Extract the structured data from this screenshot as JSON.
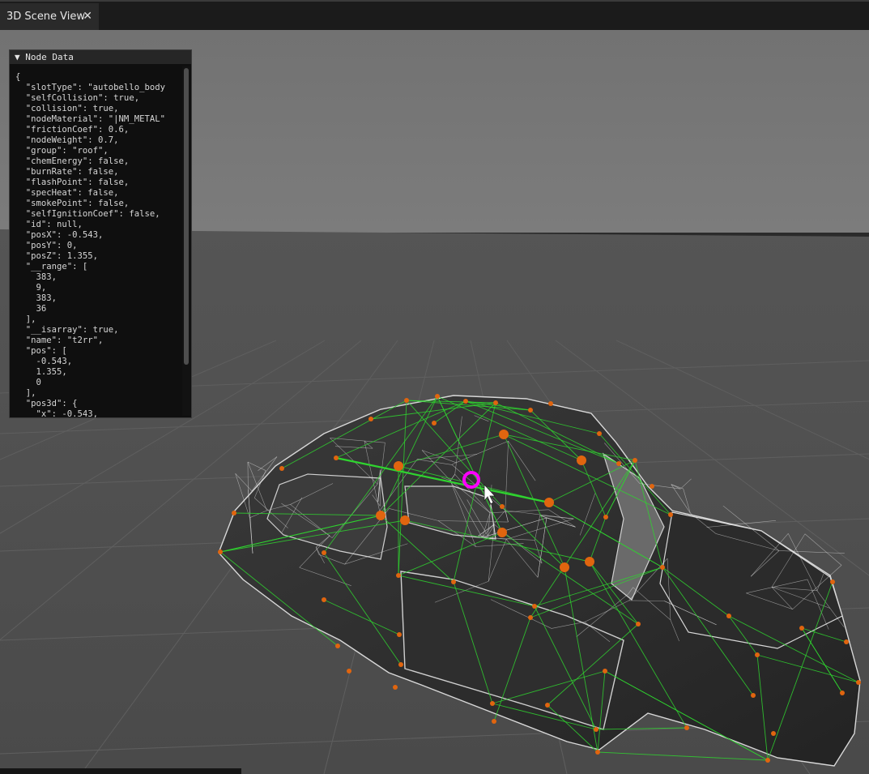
{
  "tab": {
    "label": "3D Scene View",
    "close_label": "✕"
  },
  "panel": {
    "title": "▼ Node Data",
    "json_lines": [
      "{",
      "  \"slotType\": \"autobello_body",
      "  \"selfCollision\": true,",
      "  \"collision\": true,",
      "  \"nodeMaterial\": \"|NM_METAL\"",
      "  \"frictionCoef\": 0.6,",
      "  \"nodeWeight\": 0.7,",
      "  \"group\": \"roof\",",
      "  \"chemEnergy\": false,",
      "  \"burnRate\": false,",
      "  \"flashPoint\": false,",
      "  \"specHeat\": false,",
      "  \"smokePoint\": false,",
      "  \"selfIgnitionCoef\": false,",
      "  \"id\": null,",
      "  \"posX\": -0.543,",
      "  \"posY\": 0,",
      "  \"posZ\": 1.355,",
      "  \"__range\": [",
      "    383,",
      "    9,",
      "    383,",
      "    36",
      "  ],",
      "  \"__isarray\": true,",
      "  \"name\": \"t2rr\",",
      "  \"pos\": [",
      "    -0.543,",
      "    1.355,",
      "    0",
      "  ],",
      "  \"pos3d\": {",
      "    \"x\": -0.543,"
    ]
  },
  "colors": {
    "sky": "#7a7a7a",
    "ground": "#505050",
    "mesh": "#e6e6e6",
    "beams": "#2fd42f",
    "nodes": "#e0650f",
    "selection": "#ff00ff"
  }
}
